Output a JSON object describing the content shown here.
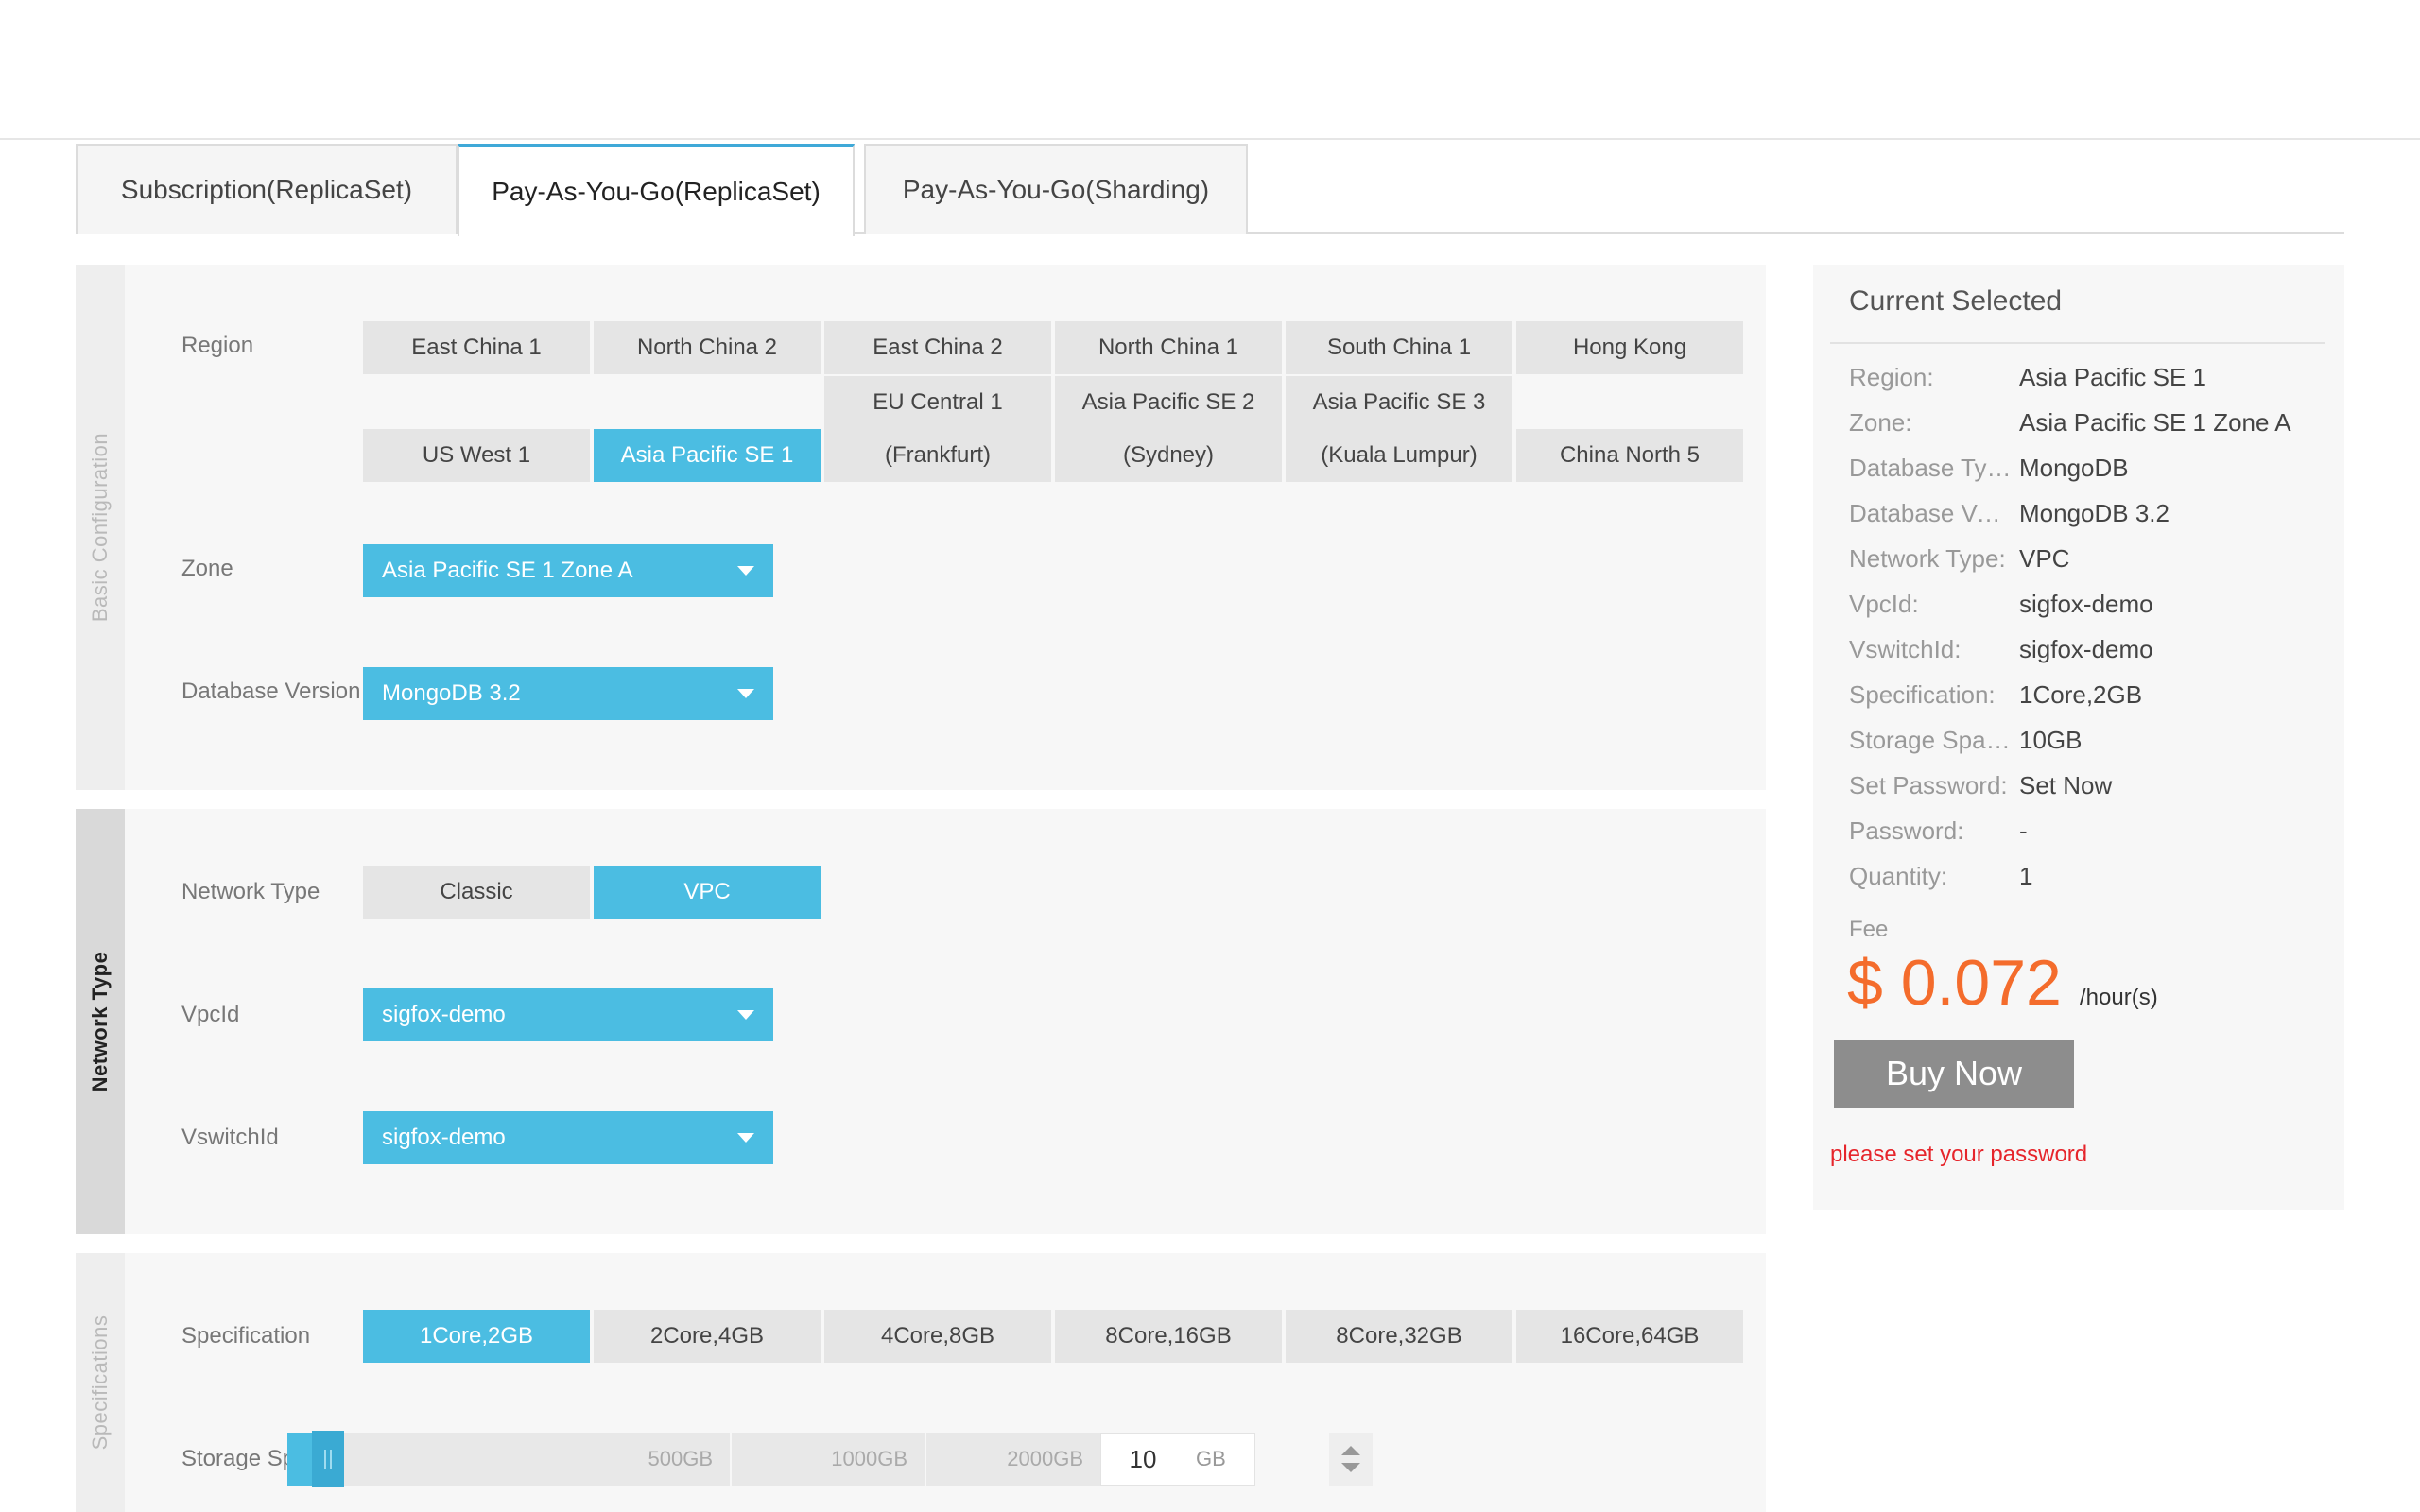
{
  "tabs": [
    {
      "label": "Subscription(ReplicaSet)"
    },
    {
      "label": "Pay-As-You-Go(ReplicaSet)",
      "active": true
    },
    {
      "label": "Pay-As-You-Go(Sharding)"
    }
  ],
  "basic": {
    "section_title": "Basic Configuration",
    "region_label": "Region",
    "regions": [
      "East China 1",
      "North China 2",
      "East China 2",
      "North China 1",
      "South China 1",
      "Hong Kong",
      "US West 1",
      "Asia Pacific SE 1",
      [
        "EU Central 1",
        "(Frankfurt)"
      ],
      [
        "Asia Pacific SE 2",
        "(Sydney)"
      ],
      [
        "Asia Pacific SE 3",
        "(Kuala Lumpur)"
      ],
      "China North 5"
    ],
    "selected_region": "Asia Pacific SE 1",
    "zone_label": "Zone",
    "zone_value": "Asia Pacific SE 1 Zone A",
    "dbversion_label": "Database Version",
    "dbversion_value": "MongoDB 3.2"
  },
  "network": {
    "section_title": "Network Type",
    "type_label": "Network Type",
    "options": [
      "Classic",
      "VPC"
    ],
    "selected": "VPC",
    "vpcid_label": "VpcId",
    "vpcid_value": "sigfox-demo",
    "vswitch_label": "VswitchId",
    "vswitch_value": "sigfox-demo"
  },
  "specs": {
    "section_title": "Specifications",
    "spec_label": "Specification",
    "options": [
      "1Core,2GB",
      "2Core,4GB",
      "4Core,8GB",
      "8Core,16GB",
      "8Core,32GB",
      "16Core,64GB"
    ],
    "selected": "1Core,2GB",
    "storage_label": "Storage Space",
    "storage_ticks": [
      "500GB",
      "1000GB",
      "2000GB"
    ],
    "storage_value": "10",
    "storage_unit": "GB"
  },
  "summary": {
    "title": "Current Selected",
    "rows": [
      {
        "k": "Region:",
        "v": "Asia Pacific SE 1"
      },
      {
        "k": "Zone:",
        "v": "Asia Pacific SE 1 Zone A"
      },
      {
        "k": "Database Type:",
        "v": "MongoDB"
      },
      {
        "k": "Database Version:",
        "v": "MongoDB 3.2"
      },
      {
        "k": "Network Type:",
        "v": "VPC"
      },
      {
        "k": "VpcId:",
        "v": "sigfox-demo"
      },
      {
        "k": "VswitchId:",
        "v": "sigfox-demo"
      },
      {
        "k": "Specification:",
        "v": "1Core,2GB"
      },
      {
        "k": "Storage Space:",
        "v": "10GB"
      },
      {
        "k": "Set Password:",
        "v": "Set Now"
      },
      {
        "k": "Password:",
        "v": "-"
      },
      {
        "k": "Quantity:",
        "v": "1"
      }
    ],
    "fee_label": "Fee",
    "fee_amount": "$ 0.072",
    "fee_unit": "/hour(s)",
    "buy_label": "Buy Now",
    "warning": "please set your password"
  },
  "colors": {
    "accent": "#4bbde2",
    "fee": "#f46c2c",
    "warning": "#e6252b",
    "buy": "#8d8d8d"
  }
}
